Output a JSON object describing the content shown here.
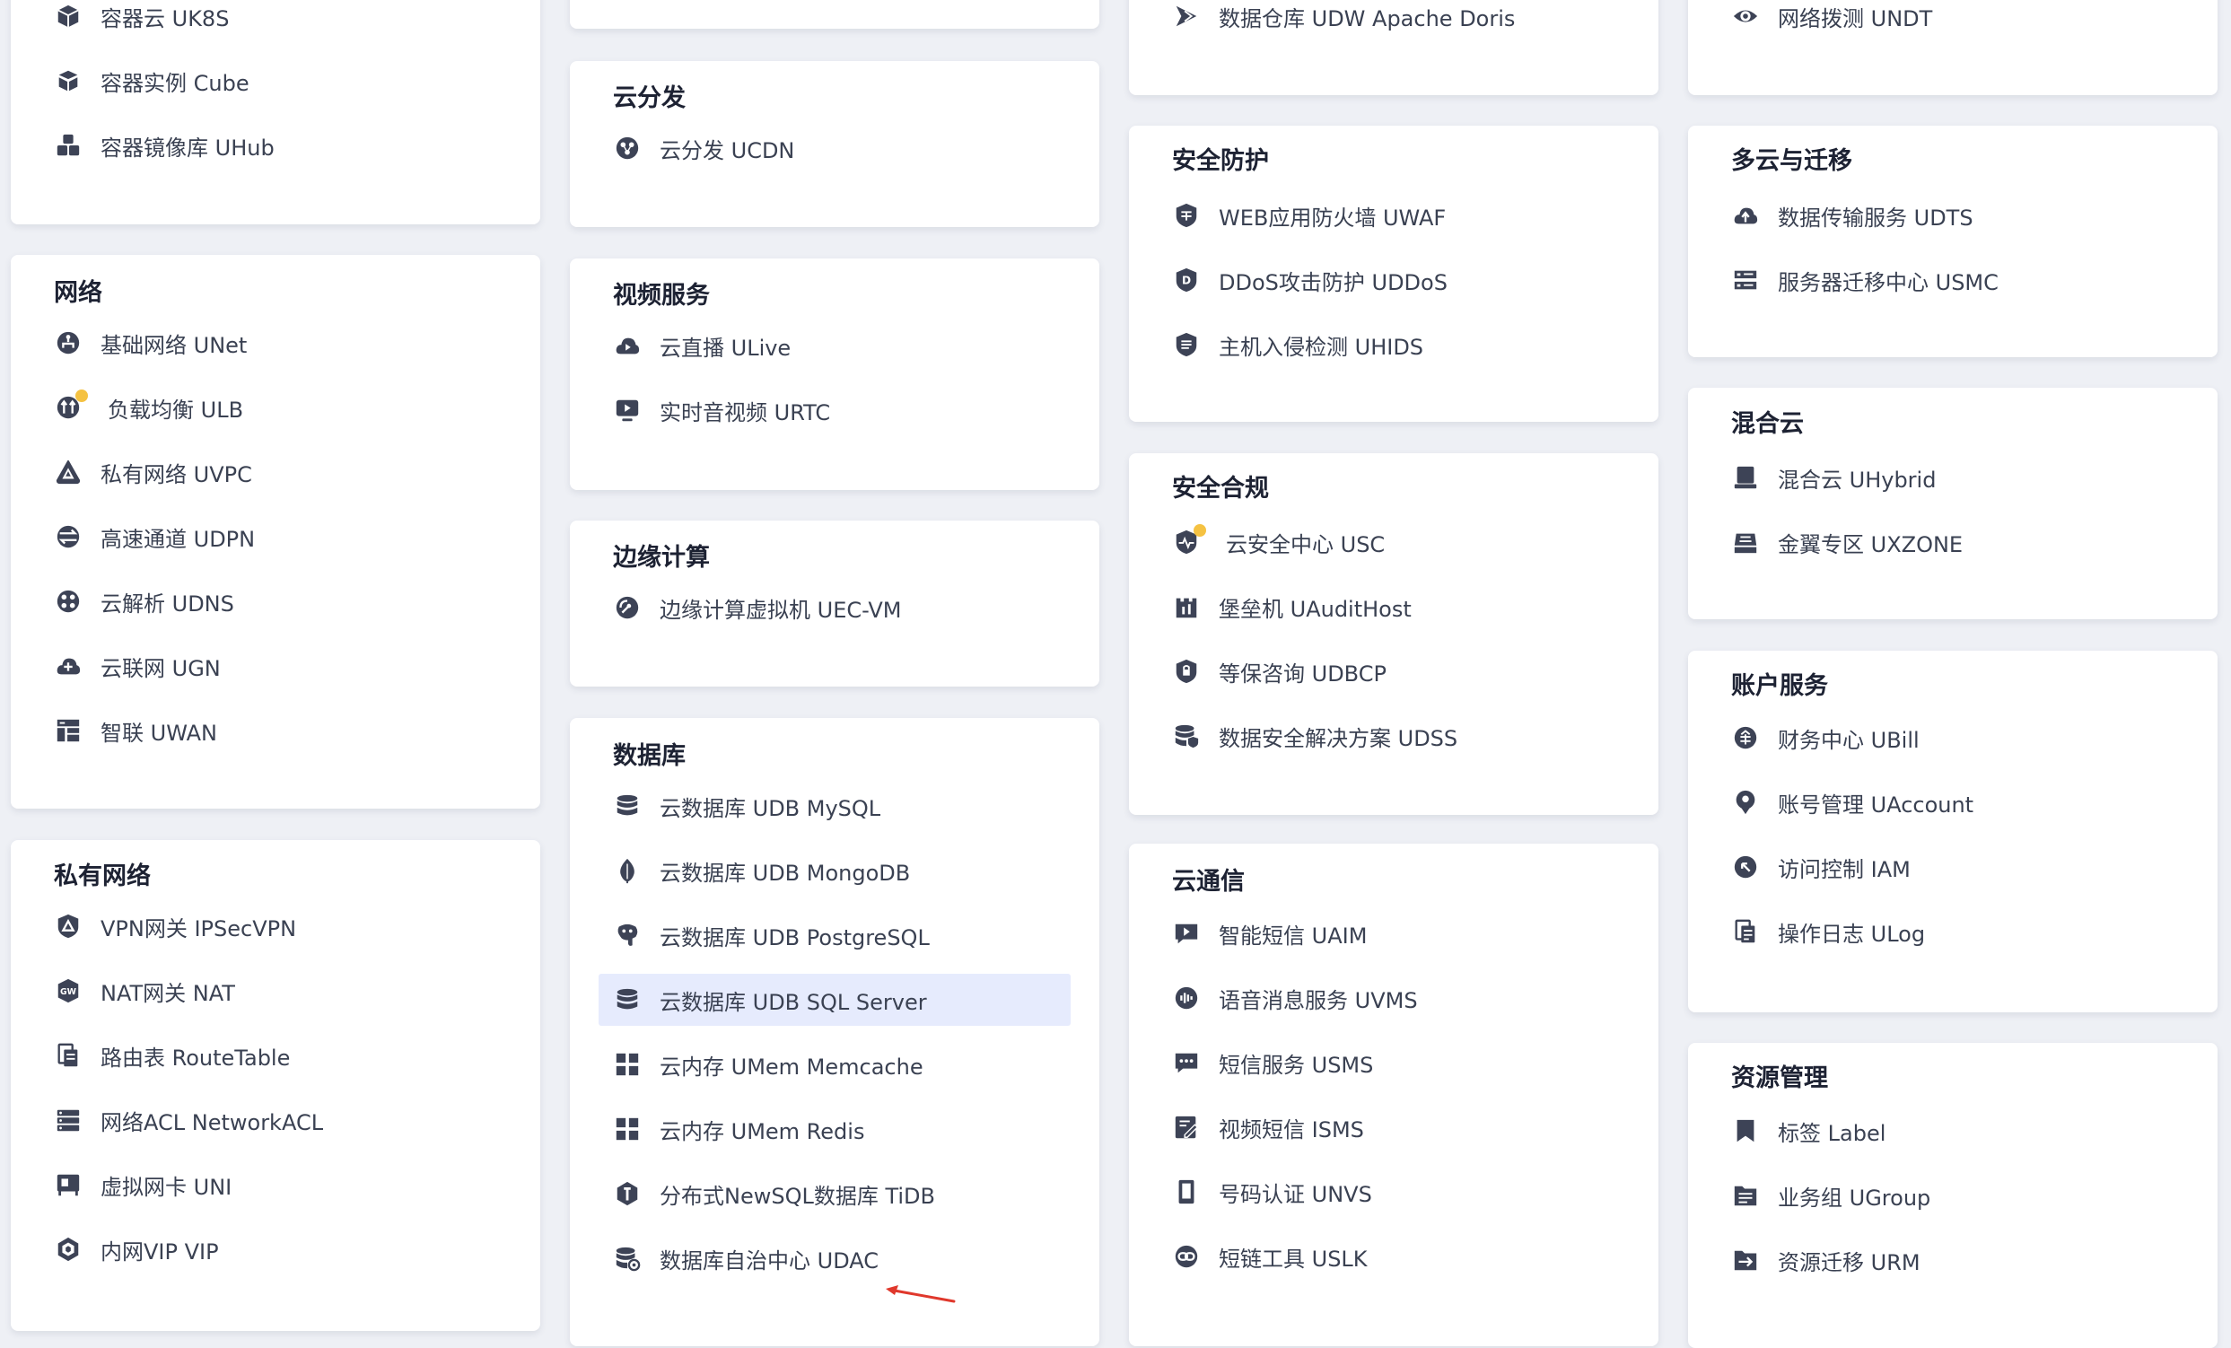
{
  "columns": [
    {
      "cards": [
        {
          "title": "",
          "items": [
            {
              "label": "容器云 UK8S",
              "icon": "box-icon"
            },
            {
              "label": "容器实例 Cube",
              "icon": "cube-icon"
            },
            {
              "label": "容器镜像库 UHub",
              "icon": "boxes-icon"
            }
          ]
        },
        {
          "title": "网络",
          "items": [
            {
              "label": "基础网络 UNet",
              "icon": "network-icon"
            },
            {
              "label": "负载均衡 ULB",
              "icon": "load-balance-icon",
              "dot": true
            },
            {
              "label": "私有网络 UVPC",
              "icon": "vpc-icon"
            },
            {
              "label": "高速通道 UDPN",
              "icon": "express-icon"
            },
            {
              "label": "云解析 UDNS",
              "icon": "dns-icon"
            },
            {
              "label": "云联网 UGN",
              "icon": "cloud-network-icon"
            },
            {
              "label": "智联 UWAN",
              "icon": "wan-icon"
            }
          ]
        },
        {
          "title": "私有网络",
          "items": [
            {
              "label": "VPN网关 IPSecVPN",
              "icon": "vpn-shield-icon"
            },
            {
              "label": "NAT网关 NAT",
              "icon": "nat-icon"
            },
            {
              "label": "路由表 RouteTable",
              "icon": "route-table-icon"
            },
            {
              "label": "网络ACL NetworkACL",
              "icon": "acl-icon"
            },
            {
              "label": "虚拟网卡 UNI",
              "icon": "nic-icon"
            },
            {
              "label": "内网VIP VIP",
              "icon": "vip-icon"
            }
          ]
        }
      ]
    },
    {
      "cards": [
        {
          "title": "",
          "items": []
        },
        {
          "title": "云分发",
          "items": [
            {
              "label": "云分发 UCDN",
              "icon": "cdn-icon"
            }
          ]
        },
        {
          "title": "视频服务",
          "items": [
            {
              "label": "云直播 ULive",
              "icon": "live-cloud-icon"
            },
            {
              "label": "实时音视频 URTC",
              "icon": "video-play-icon"
            }
          ]
        },
        {
          "title": "边缘计算",
          "items": [
            {
              "label": "边缘计算虚拟机 UEC-VM",
              "icon": "edge-gauge-icon"
            }
          ]
        },
        {
          "title": "数据库",
          "items": [
            {
              "label": "云数据库 UDB MySQL",
              "icon": "database-icon"
            },
            {
              "label": "云数据库 UDB MongoDB",
              "icon": "mongodb-leaf-icon"
            },
            {
              "label": "云数据库 UDB PostgreSQL",
              "icon": "postgresql-icon"
            },
            {
              "label": "云数据库 UDB SQL Server",
              "icon": "database-icon",
              "selected": true
            },
            {
              "label": "云内存 UMem Memcache",
              "icon": "grid-icon"
            },
            {
              "label": "云内存 UMem Redis",
              "icon": "grid-icon"
            },
            {
              "label": "分布式NewSQL数据库 TiDB",
              "icon": "tidb-icon"
            },
            {
              "label": "数据库自治中心 UDAC",
              "icon": "db-autonomy-icon"
            }
          ]
        }
      ]
    },
    {
      "cards": [
        {
          "title": "",
          "items": [
            {
              "label": "数据仓库 UDW Apache Doris",
              "icon": "warehouse-icon"
            }
          ]
        },
        {
          "title": "安全防护",
          "items": [
            {
              "label": "WEB应用防火墙 UWAF",
              "icon": "waf-shield-icon"
            },
            {
              "label": "DDoS攻击防护 UDDoS",
              "icon": "ddos-shield-icon"
            },
            {
              "label": "主机入侵检测 UHIDS",
              "icon": "hids-shield-icon"
            }
          ]
        },
        {
          "title": "安全合规",
          "items": [
            {
              "label": "云安全中心 USC",
              "icon": "security-center-icon",
              "dot": true
            },
            {
              "label": "堡垒机 UAuditHost",
              "icon": "bastion-icon"
            },
            {
              "label": "等保咨询 UDBCP",
              "icon": "compliance-shield-icon"
            },
            {
              "label": "数据安全解决方案 UDSS",
              "icon": "data-security-icon"
            }
          ]
        },
        {
          "title": "云通信",
          "items": [
            {
              "label": "智能短信 UAIM",
              "icon": "sms-play-icon"
            },
            {
              "label": "语音消息服务 UVMS",
              "icon": "voice-icon"
            },
            {
              "label": "短信服务 USMS",
              "icon": "chat-icon"
            },
            {
              "label": "视频短信 ISMS",
              "icon": "video-sms-icon"
            },
            {
              "label": "号码认证 UNVS",
              "icon": "phone-icon"
            },
            {
              "label": "短链工具 USLK",
              "icon": "link-icon"
            }
          ]
        }
      ]
    },
    {
      "cards": [
        {
          "title": "",
          "items": [
            {
              "label": "网络拨测 UNDT",
              "icon": "eye-icon"
            }
          ]
        },
        {
          "title": "多云与迁移",
          "items": [
            {
              "label": "数据传输服务 UDTS",
              "icon": "upload-cloud-icon"
            },
            {
              "label": "服务器迁移中心 USMC",
              "icon": "migration-icon"
            }
          ]
        },
        {
          "title": "混合云",
          "items": [
            {
              "label": "混合云 UHybrid",
              "icon": "hybrid-icon"
            },
            {
              "label": "金翼专区 UXZONE",
              "icon": "zone-icon"
            }
          ]
        },
        {
          "title": "账户服务",
          "items": [
            {
              "label": "财务中心 UBill",
              "icon": "bill-icon"
            },
            {
              "label": "账号管理 UAccount",
              "icon": "account-pin-icon"
            },
            {
              "label": "访问控制 IAM",
              "icon": "access-control-icon"
            },
            {
              "label": "操作日志 ULog",
              "icon": "log-icon"
            }
          ]
        },
        {
          "title": "资源管理",
          "items": [
            {
              "label": "标签 Label",
              "icon": "tag-icon"
            },
            {
              "label": "业务组 UGroup",
              "icon": "group-folder-icon"
            },
            {
              "label": "资源迁移 URM",
              "icon": "resource-move-icon"
            }
          ]
        }
      ]
    }
  ],
  "colors": {
    "icon": "#3d4356",
    "dot": "#f5c242",
    "selected_bg": "#e6ebfd",
    "arrow": "#e0382c"
  }
}
